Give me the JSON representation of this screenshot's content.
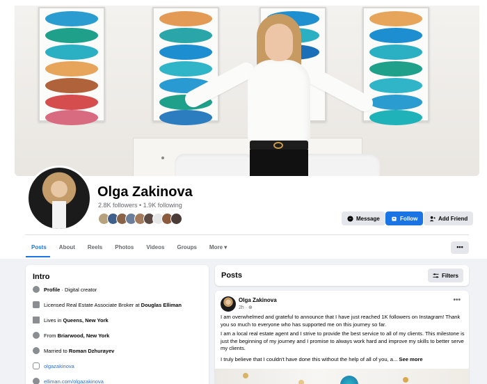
{
  "profile": {
    "name": "Olga Zakinova",
    "stats": "2.8K followers • 1.9K following"
  },
  "actions": {
    "message": "Message",
    "follow": "Follow",
    "add_friend": "Add Friend",
    "more": "•••"
  },
  "tabs": [
    "Posts",
    "About",
    "Reels",
    "Photos",
    "Videos",
    "Groups",
    "More ▾"
  ],
  "intro": {
    "title": "Intro",
    "profile_label": "Profile",
    "profile_value": " · Digital creator",
    "job_prefix": "Licensed Real Estate Associate Broker at ",
    "job_company": "Douglas Elliman",
    "lives_prefix": "Lives in ",
    "lives_place": "Queens, New York",
    "from_prefix": "From ",
    "from_place": "Briarwood, New York",
    "married_prefix": "Married to ",
    "married_name": "Roman Dzhurayev",
    "instagram": "olgazakinova",
    "website": "elliman.com/olgazakinova"
  },
  "posts_section": {
    "title": "Posts",
    "filters": "Filters"
  },
  "post": {
    "author": "Olga Zakinova",
    "time": "2h · ",
    "p1": "I am overwhelmed and grateful to announce that I have just reached 1K followers on Instagram! Thank you so much to everyone who has supported me on this journey so far.",
    "p2": "I am a local real estate agent and I strive to provide the best service to all of my clients. This milestone is just the beginning of my journey and I promise to always work hard and improve my skills to better serve my clients.",
    "p3": "I truly believe that I couldn't have done this without the help of all of you, a... ",
    "see_more": "See more"
  },
  "colors": {
    "accent": "#1b74e4",
    "muted": "#65676b",
    "link": "#216fdb"
  }
}
